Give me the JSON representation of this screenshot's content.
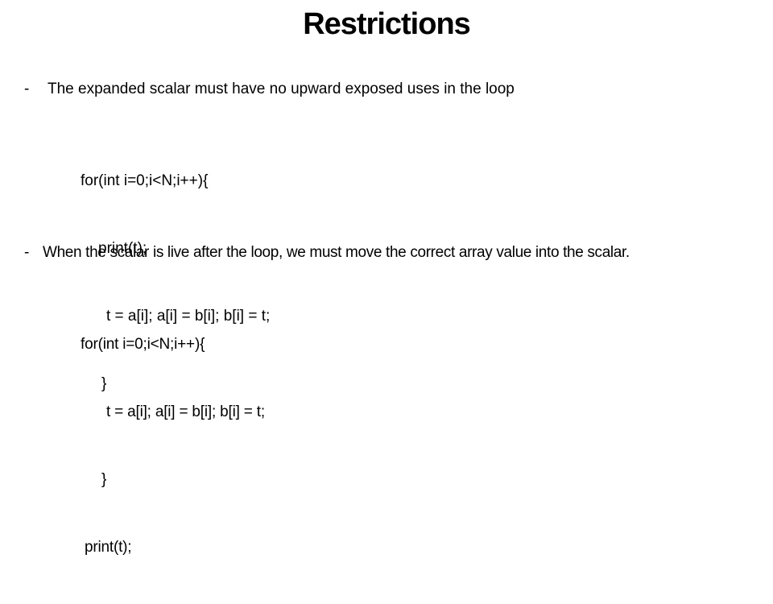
{
  "slide": {
    "title": "Restrictions",
    "bullets": [
      {
        "marker": "-",
        "text": "The expanded scalar must have no upward exposed uses in the loop",
        "code": [
          "for(int i=0;i<N;i++){",
          "print(t);",
          "t = a[i]; a[i] = b[i]; b[i] = t;",
          "}"
        ]
      },
      {
        "marker": "-",
        "text": "When the scalar is live after the loop, we must move the correct array value into the scalar.",
        "code": [
          "for(int i=0;i<N;i++){",
          "t = a[i]; a[i] = b[i]; b[i] = t;",
          "}",
          "print(t);"
        ]
      }
    ]
  }
}
